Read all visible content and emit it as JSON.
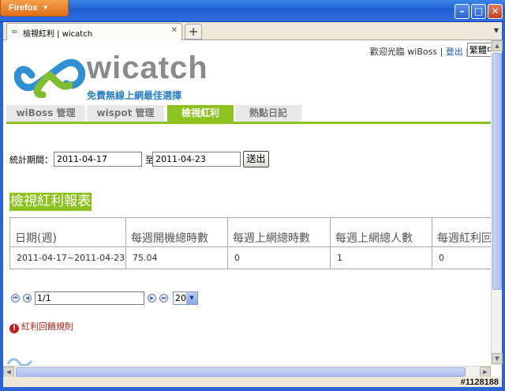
{
  "browser": {
    "menu_label": "Firefox",
    "tab_title": "檢視紅利 | wicatch",
    "new_tab_symbol": "+"
  },
  "header": {
    "brand": "wicatch",
    "slogan": "免費無線上網最佳選擇",
    "welcome": "歡迎光臨 wiBoss",
    "separator": "|",
    "logout": "登出",
    "language": "繁體中文"
  },
  "nav": {
    "tabs": [
      {
        "label": "wiBoss 管理",
        "active": false
      },
      {
        "label": "wispot 管理",
        "active": false
      },
      {
        "label": "檢視紅利",
        "active": true
      },
      {
        "label": "熱點日記",
        "active": false
      }
    ]
  },
  "filter": {
    "label": "統計期間：",
    "start_date": "2011-04-17",
    "to_label": "至",
    "end_date": "2011-04-23",
    "submit": "送出"
  },
  "report": {
    "title": "檢視紅利報表",
    "columns": [
      "日期(週)",
      "每週開機總時數",
      "每週上網總時數",
      "每週上網總人數",
      "每週紅利回"
    ],
    "rows": [
      [
        "2011-04-17~2011-04-23",
        "75.04",
        "0",
        "1",
        "0"
      ]
    ]
  },
  "pager": {
    "page": "1/1",
    "page_size": "20"
  },
  "rules_link": "紅利回饋規則",
  "watermark": "#1128188",
  "colors": {
    "accent_green": "#8ec21f",
    "link_blue": "#1a55b8",
    "xp_blue": "#2a64d6"
  }
}
